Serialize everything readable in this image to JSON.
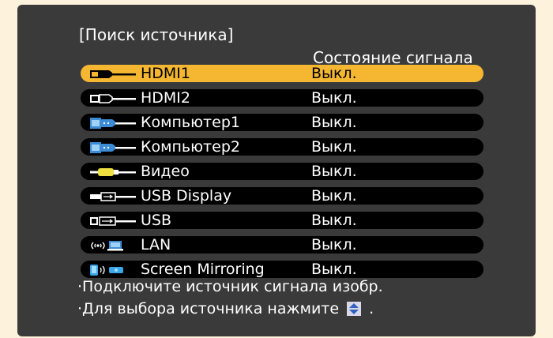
{
  "title": "[Поиск источника]",
  "column_header": "Состояние сигнала",
  "colors": {
    "background": "#fdf3dc",
    "screen": "#3a3a3a",
    "row": "#000000",
    "selected_row": "#f5b731",
    "text": "#ffffff",
    "selected_text": "#000000"
  },
  "sources": [
    {
      "label": "HDMI1",
      "status": "Выкл.",
      "icon": "hdmi-connector-icon",
      "selected": true
    },
    {
      "label": "HDMI2",
      "status": "Выкл.",
      "icon": "hdmi-connector-icon",
      "selected": false
    },
    {
      "label": "Компьютер1",
      "status": "Выкл.",
      "icon": "vga-connector-icon",
      "selected": false
    },
    {
      "label": "Компьютер2",
      "status": "Выкл.",
      "icon": "vga-connector-icon",
      "selected": false
    },
    {
      "label": "Видео",
      "status": "Выкл.",
      "icon": "rca-video-connector-icon",
      "selected": false
    },
    {
      "label": "USB Display",
      "status": "Выкл.",
      "icon": "usb-connector-icon",
      "selected": false
    },
    {
      "label": "USB",
      "status": "Выкл.",
      "icon": "usb-port-icon",
      "selected": false
    },
    {
      "label": "LAN",
      "status": "Выкл.",
      "icon": "wireless-lan-icon",
      "selected": false
    },
    {
      "label": "Screen Mirroring",
      "status": "Выкл.",
      "icon": "screen-mirroring-icon",
      "selected": false
    }
  ],
  "footer": {
    "line1": "·Подключите источник сигнала изобр.",
    "line2_prefix": "·Для выбора источника нажмите",
    "line2_icon": "up-down-arrow-icon",
    "line2_suffix": "."
  }
}
